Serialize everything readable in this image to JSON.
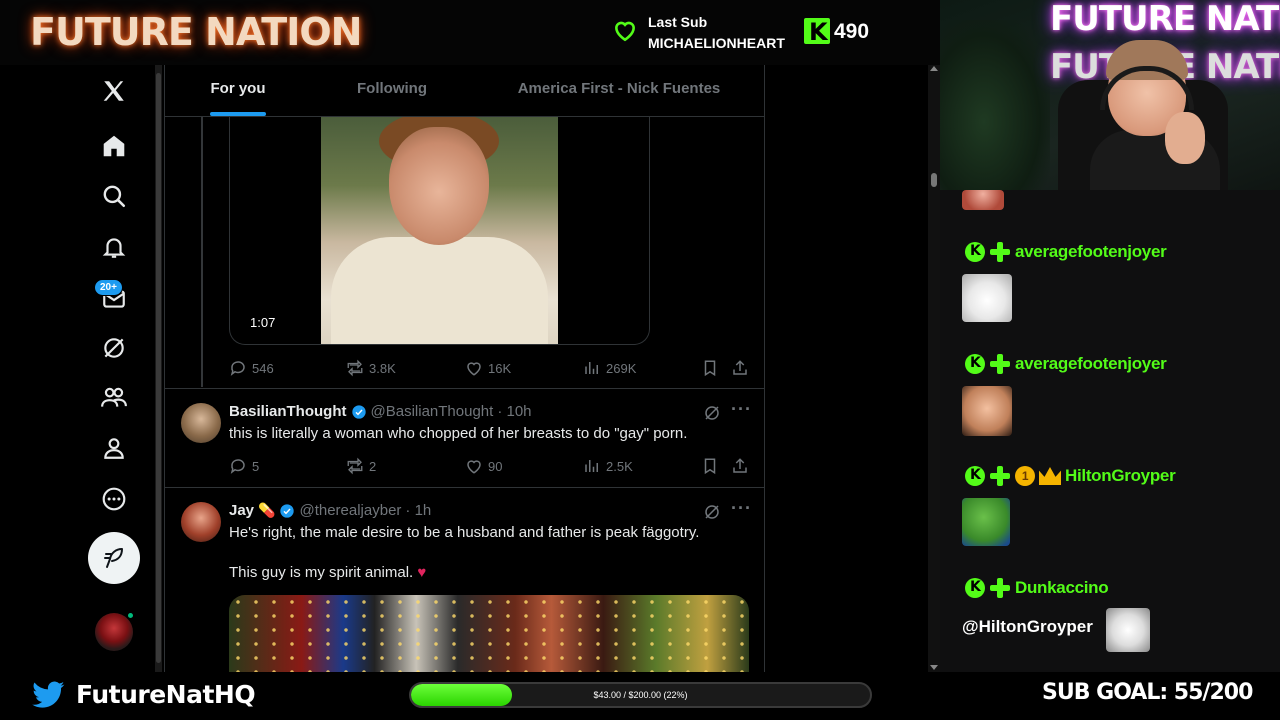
{
  "overlay": {
    "brand": "FUTURE NATION",
    "last_sub_label": "Last Sub",
    "last_sub_name": "MICHAELIONHEART",
    "kick_followers": "490",
    "accent_green": "#53fc18"
  },
  "x": {
    "nav": {
      "items": [
        "x-logo",
        "home-icon",
        "search-icon",
        "notifications-icon",
        "messages-icon",
        "grok-icon",
        "communities-icon",
        "profile-icon",
        "more-icon"
      ],
      "messages_badge": "20+"
    },
    "tabs": [
      {
        "label": "For you",
        "active": true
      },
      {
        "label": "Following",
        "active": false
      },
      {
        "label": "America First - Nick Fuentes",
        "active": false
      }
    ],
    "video_tweet": {
      "duration": "1:07",
      "replies": "546",
      "reposts": "3.8K",
      "likes": "16K",
      "views": "269K"
    },
    "tweet1": {
      "name": "BasilianThought",
      "handle": "@BasilianThought",
      "time": "· 10h",
      "text": "this is literally a woman who chopped of her breasts to do \"gay\" porn.",
      "replies": "5",
      "reposts": "2",
      "likes": "90",
      "views": "2.5K"
    },
    "tweet2": {
      "name": "Jay",
      "name_emoji": "💊",
      "handle": "@therealjayber",
      "time": "· 1h",
      "text_line1": "He's right, the male desire to be a husband and father is peak fäggotry.",
      "text_line2": "This guy is my spirit animal.",
      "text_emoji": "♥"
    }
  },
  "chat": {
    "messages": [
      {
        "user": "averagefootenjoyer",
        "content": "cat emote"
      },
      {
        "user": "averagefootenjoyer",
        "content": "shocked face emote"
      },
      {
        "user": "HiltonGroyper",
        "coin": "1",
        "content": "pepe emote"
      },
      {
        "user": "Dunkaccino",
        "mention": "@HiltonGroyper",
        "content": "cat emote"
      }
    ]
  },
  "bottom": {
    "twitter_handle": "FutureNatHQ",
    "goal_text": "$43.00 / $200.00 (22%)",
    "goal_fraction": 0.22,
    "sub_goal": "SUB GOAL: 55/200"
  }
}
